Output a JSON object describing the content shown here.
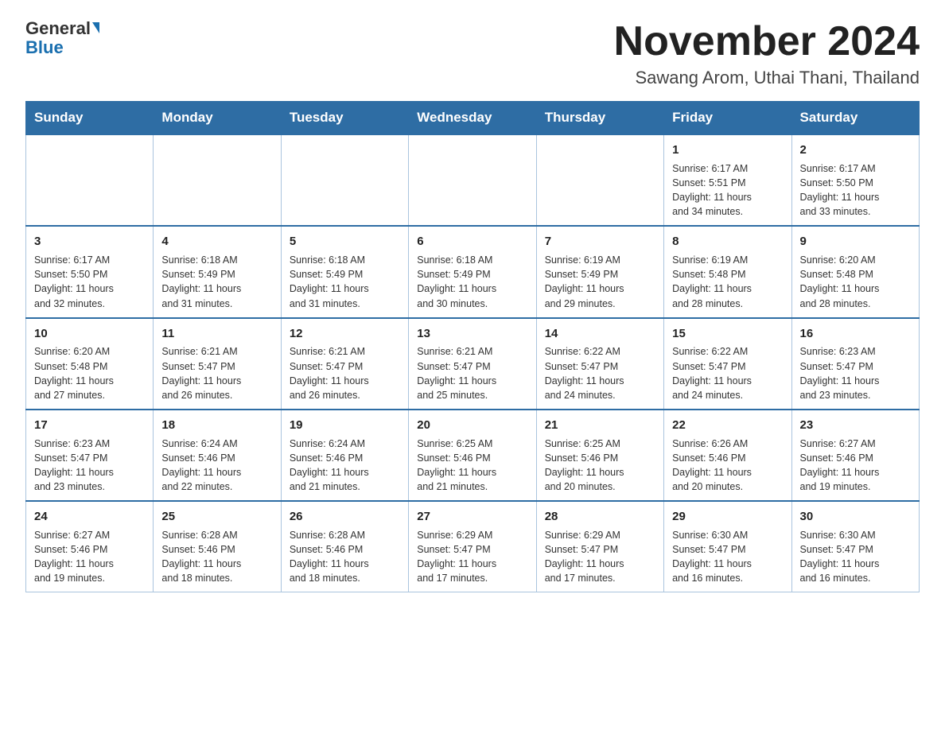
{
  "header": {
    "logo_general": "General",
    "logo_blue": "Blue",
    "month_title": "November 2024",
    "location": "Sawang Arom, Uthai Thani, Thailand"
  },
  "days_of_week": [
    "Sunday",
    "Monday",
    "Tuesday",
    "Wednesday",
    "Thursday",
    "Friday",
    "Saturday"
  ],
  "weeks": [
    [
      {
        "day": "",
        "info": ""
      },
      {
        "day": "",
        "info": ""
      },
      {
        "day": "",
        "info": ""
      },
      {
        "day": "",
        "info": ""
      },
      {
        "day": "",
        "info": ""
      },
      {
        "day": "1",
        "info": "Sunrise: 6:17 AM\nSunset: 5:51 PM\nDaylight: 11 hours\nand 34 minutes."
      },
      {
        "day": "2",
        "info": "Sunrise: 6:17 AM\nSunset: 5:50 PM\nDaylight: 11 hours\nand 33 minutes."
      }
    ],
    [
      {
        "day": "3",
        "info": "Sunrise: 6:17 AM\nSunset: 5:50 PM\nDaylight: 11 hours\nand 32 minutes."
      },
      {
        "day": "4",
        "info": "Sunrise: 6:18 AM\nSunset: 5:49 PM\nDaylight: 11 hours\nand 31 minutes."
      },
      {
        "day": "5",
        "info": "Sunrise: 6:18 AM\nSunset: 5:49 PM\nDaylight: 11 hours\nand 31 minutes."
      },
      {
        "day": "6",
        "info": "Sunrise: 6:18 AM\nSunset: 5:49 PM\nDaylight: 11 hours\nand 30 minutes."
      },
      {
        "day": "7",
        "info": "Sunrise: 6:19 AM\nSunset: 5:49 PM\nDaylight: 11 hours\nand 29 minutes."
      },
      {
        "day": "8",
        "info": "Sunrise: 6:19 AM\nSunset: 5:48 PM\nDaylight: 11 hours\nand 28 minutes."
      },
      {
        "day": "9",
        "info": "Sunrise: 6:20 AM\nSunset: 5:48 PM\nDaylight: 11 hours\nand 28 minutes."
      }
    ],
    [
      {
        "day": "10",
        "info": "Sunrise: 6:20 AM\nSunset: 5:48 PM\nDaylight: 11 hours\nand 27 minutes."
      },
      {
        "day": "11",
        "info": "Sunrise: 6:21 AM\nSunset: 5:47 PM\nDaylight: 11 hours\nand 26 minutes."
      },
      {
        "day": "12",
        "info": "Sunrise: 6:21 AM\nSunset: 5:47 PM\nDaylight: 11 hours\nand 26 minutes."
      },
      {
        "day": "13",
        "info": "Sunrise: 6:21 AM\nSunset: 5:47 PM\nDaylight: 11 hours\nand 25 minutes."
      },
      {
        "day": "14",
        "info": "Sunrise: 6:22 AM\nSunset: 5:47 PM\nDaylight: 11 hours\nand 24 minutes."
      },
      {
        "day": "15",
        "info": "Sunrise: 6:22 AM\nSunset: 5:47 PM\nDaylight: 11 hours\nand 24 minutes."
      },
      {
        "day": "16",
        "info": "Sunrise: 6:23 AM\nSunset: 5:47 PM\nDaylight: 11 hours\nand 23 minutes."
      }
    ],
    [
      {
        "day": "17",
        "info": "Sunrise: 6:23 AM\nSunset: 5:47 PM\nDaylight: 11 hours\nand 23 minutes."
      },
      {
        "day": "18",
        "info": "Sunrise: 6:24 AM\nSunset: 5:46 PM\nDaylight: 11 hours\nand 22 minutes."
      },
      {
        "day": "19",
        "info": "Sunrise: 6:24 AM\nSunset: 5:46 PM\nDaylight: 11 hours\nand 21 minutes."
      },
      {
        "day": "20",
        "info": "Sunrise: 6:25 AM\nSunset: 5:46 PM\nDaylight: 11 hours\nand 21 minutes."
      },
      {
        "day": "21",
        "info": "Sunrise: 6:25 AM\nSunset: 5:46 PM\nDaylight: 11 hours\nand 20 minutes."
      },
      {
        "day": "22",
        "info": "Sunrise: 6:26 AM\nSunset: 5:46 PM\nDaylight: 11 hours\nand 20 minutes."
      },
      {
        "day": "23",
        "info": "Sunrise: 6:27 AM\nSunset: 5:46 PM\nDaylight: 11 hours\nand 19 minutes."
      }
    ],
    [
      {
        "day": "24",
        "info": "Sunrise: 6:27 AM\nSunset: 5:46 PM\nDaylight: 11 hours\nand 19 minutes."
      },
      {
        "day": "25",
        "info": "Sunrise: 6:28 AM\nSunset: 5:46 PM\nDaylight: 11 hours\nand 18 minutes."
      },
      {
        "day": "26",
        "info": "Sunrise: 6:28 AM\nSunset: 5:46 PM\nDaylight: 11 hours\nand 18 minutes."
      },
      {
        "day": "27",
        "info": "Sunrise: 6:29 AM\nSunset: 5:47 PM\nDaylight: 11 hours\nand 17 minutes."
      },
      {
        "day": "28",
        "info": "Sunrise: 6:29 AM\nSunset: 5:47 PM\nDaylight: 11 hours\nand 17 minutes."
      },
      {
        "day": "29",
        "info": "Sunrise: 6:30 AM\nSunset: 5:47 PM\nDaylight: 11 hours\nand 16 minutes."
      },
      {
        "day": "30",
        "info": "Sunrise: 6:30 AM\nSunset: 5:47 PM\nDaylight: 11 hours\nand 16 minutes."
      }
    ]
  ]
}
